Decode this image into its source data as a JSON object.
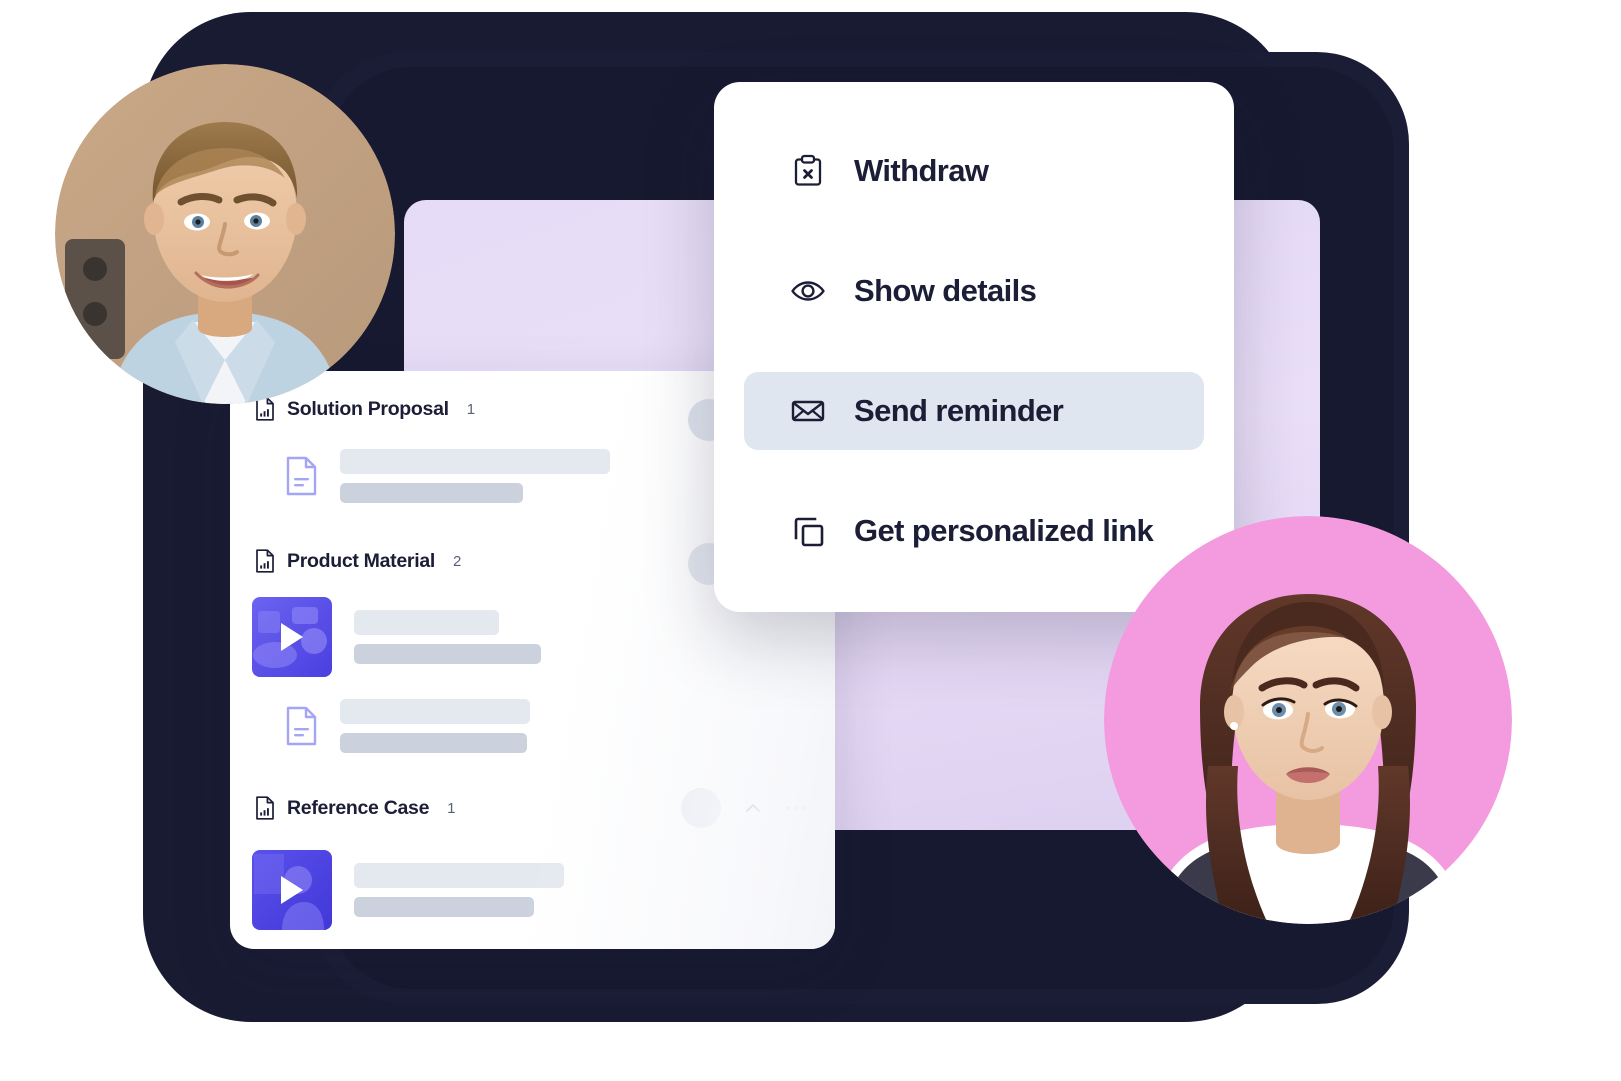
{
  "theme": {
    "frame_color": "#191b33",
    "card_bg": "#ffffff",
    "lavender": "#e6dcf7",
    "accent_purple": "#4f46e5",
    "text_dark": "#1b1e36",
    "highlight_bg": "#dfe6ef",
    "placeholder_light": "#e4e8ef",
    "placeholder_dark": "#ccd2dd",
    "avatar_pink": "#f49be0"
  },
  "context_menu": {
    "items": [
      {
        "label": "Withdraw",
        "icon": "clipboard-x-icon",
        "selected": false
      },
      {
        "label": "Show details",
        "icon": "eye-icon",
        "selected": false
      },
      {
        "label": "Send reminder",
        "icon": "envelope-icon",
        "selected": true
      },
      {
        "label": "Get personalized link",
        "icon": "copy-icon",
        "selected": false
      }
    ]
  },
  "document_list": {
    "sections": [
      {
        "title": "Solution Proposal",
        "count": "1",
        "icon": "document-chart-icon",
        "has_actions": false,
        "items": [
          {
            "type": "document",
            "icon": "file-icon",
            "title_width": 270,
            "subtitle_width": 183
          }
        ]
      },
      {
        "title": "Product Material",
        "count": "2",
        "icon": "document-chart-icon",
        "has_actions": false,
        "items": [
          {
            "type": "video",
            "icon": "video-thumbnail",
            "title_width": 145,
            "subtitle_width": 187
          },
          {
            "type": "document",
            "icon": "file-icon",
            "title_width": 190,
            "subtitle_width": 187
          }
        ]
      },
      {
        "title": "Reference Case",
        "count": "1",
        "icon": "document-chart-icon",
        "has_actions": true,
        "actions": {
          "avatar": "avatar-placeholder",
          "collapse": "chevron-up-icon",
          "more": "more-options-icon"
        },
        "items": [
          {
            "type": "video",
            "icon": "video-thumbnail",
            "title_width": 210,
            "subtitle_width": 180
          }
        ]
      }
    ]
  },
  "avatars": [
    {
      "name": "male-portrait-avatar",
      "position": "top-left",
      "ring": "none"
    },
    {
      "name": "female-portrait-avatar",
      "position": "bottom-right",
      "ring": "pink"
    }
  ]
}
